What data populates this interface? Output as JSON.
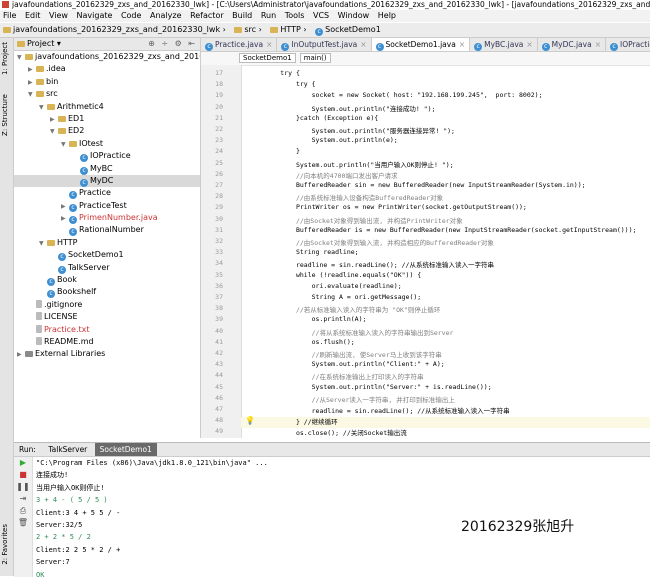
{
  "window": {
    "title": "javafoundations_20162329_zxs_and_20162330_lwk] - [C:\\Users\\Administrator\\javafoundations_20162329_zxs_and_20162330_lwk] - [javafoundations_20162329_zxs_and_20162330_lwk] - ...\\src"
  },
  "menu": [
    "File",
    "Edit",
    "View",
    "Navigate",
    "Code",
    "Analyze",
    "Refactor",
    "Build",
    "Run",
    "Tools",
    "VCS",
    "Window",
    "Help"
  ],
  "nav": {
    "project": "javafoundations_20162329_zxs_and_20162330_lwk",
    "src": "src",
    "http": "HTTP",
    "file": "SocketDemo1"
  },
  "left_tabs": {
    "project": "1: Project",
    "structure": "Z: Structure",
    "favorites": "2: Favorites"
  },
  "project_panel": {
    "title": "Project"
  },
  "tree": [
    {
      "label": "javafoundations_20162329_zxs_and_20162330_l",
      "depth": 0,
      "icon": "folder-icon",
      "open": true
    },
    {
      "label": ".idea",
      "depth": 1,
      "icon": "folder-icon",
      "open": false
    },
    {
      "label": "bin",
      "depth": 1,
      "icon": "folder-icon",
      "open": false
    },
    {
      "label": "src",
      "depth": 1,
      "icon": "folder-icon",
      "open": true
    },
    {
      "label": "Arithmetic4",
      "depth": 2,
      "icon": "folder-icon",
      "open": true
    },
    {
      "label": "ED1",
      "depth": 3,
      "icon": "folder-icon",
      "open": false
    },
    {
      "label": "ED2",
      "depth": 3,
      "icon": "folder-icon",
      "open": true
    },
    {
      "label": "IOtest",
      "depth": 4,
      "icon": "folder-icon",
      "open": true
    },
    {
      "label": "IOPractice",
      "depth": 5,
      "icon": "class-icon"
    },
    {
      "label": "MyBC",
      "depth": 5,
      "icon": "class-icon"
    },
    {
      "label": "MyDC",
      "depth": 5,
      "icon": "class-icon",
      "selected": true
    },
    {
      "label": "Practice",
      "depth": 4,
      "icon": "class-icon"
    },
    {
      "label": "PracticeTest",
      "depth": 4,
      "icon": "class-icon",
      "open": false
    },
    {
      "label": "PrimenNumber.java",
      "depth": 4,
      "icon": "class-icon",
      "open": false
    },
    {
      "label": "RationalNumber",
      "depth": 4,
      "icon": "class-icon"
    },
    {
      "label": "HTTP",
      "depth": 2,
      "icon": "folder-icon",
      "open": true
    },
    {
      "label": "SocketDemo1",
      "depth": 3,
      "icon": "class-icon"
    },
    {
      "label": "TalkServer",
      "depth": 3,
      "icon": "class-icon"
    },
    {
      "label": "Book",
      "depth": 2,
      "icon": "class-icon"
    },
    {
      "label": "Bookshelf",
      "depth": 2,
      "icon": "class-icon"
    },
    {
      "label": ".gitignore",
      "depth": 1,
      "icon": "file-icon"
    },
    {
      "label": "LICENSE",
      "depth": 1,
      "icon": "file-icon"
    },
    {
      "label": "Practice.txt",
      "depth": 1,
      "icon": "file-icon"
    },
    {
      "label": "README.md",
      "depth": 1,
      "icon": "file-icon"
    },
    {
      "label": "External Libraries",
      "depth": 0,
      "icon": "library-icon",
      "open": false
    }
  ],
  "tabs": [
    "Practice.java",
    "InOutputTest.java",
    "SocketDemo1.java",
    "MyBC.java",
    "MyDC.java",
    "IOPractice.java"
  ],
  "active_tab": 2,
  "code_crumbs": [
    "SocketDemo1",
    "main()"
  ],
  "code_lines": [
    {
      "n": "17",
      "t": "        try {"
    },
    {
      "n": "18",
      "t": "            try {"
    },
    {
      "n": "19",
      "t": "                socket = new Socket( host: \"192.168.199.245\",  port: 8002);"
    },
    {
      "n": "20",
      "t": "                System.out.println(\"连接成功! \");"
    },
    {
      "n": "21",
      "t": "            }catch (Exception e){"
    },
    {
      "n": "22",
      "t": "                System.out.println(\"服务器连接异常! \");"
    },
    {
      "n": "23",
      "t": "                System.out.println(e);"
    },
    {
      "n": "24",
      "t": "            }"
    },
    {
      "n": "25",
      "t": "            System.out.println(\"当用户输入OK则停止! \");"
    },
    {
      "n": "26",
      "t": "            //向本机的4700端口发出客户请求"
    },
    {
      "n": "27",
      "t": "            BufferedReader sin = new BufferedReader(new InputStreamReader(System.in));"
    },
    {
      "n": "28",
      "t": "            //由系统标准输入设备构造BufferedReader对象"
    },
    {
      "n": "29",
      "t": "            PrintWriter os = new PrintWriter(socket.getOutputStream());"
    },
    {
      "n": "30",
      "t": "            //由Socket对象得到输出流, 并构造PrintWriter对象"
    },
    {
      "n": "31",
      "t": "            BufferedReader is = new BufferedReader(new InputStreamReader(socket.getInputStream()));"
    },
    {
      "n": "32",
      "t": "            //由Socket对象得到输入流, 并构造相应的BufferedReader对象"
    },
    {
      "n": "33",
      "t": "            String readline;"
    },
    {
      "n": "34",
      "t": "            readline = sin.readLine(); //从系统标准输入读入一字符串"
    },
    {
      "n": "35",
      "t": "            while (!readline.equals(\"OK\")) {"
    },
    {
      "n": "36",
      "t": "                ori.evaluate(readline);"
    },
    {
      "n": "37",
      "t": "                String A = ori.getMessage();"
    },
    {
      "n": "38",
      "t": "            //若从标准输入读入的字符串为 \"OK\"则停止循环"
    },
    {
      "n": "39",
      "t": "                os.println(A);"
    },
    {
      "n": "40",
      "t": "                //将从系统标准输入读入的字符串输出到Server"
    },
    {
      "n": "41",
      "t": "                os.flush();"
    },
    {
      "n": "42",
      "t": "                //刷新输出流, 使Server马上收到该字符串"
    },
    {
      "n": "43",
      "t": "                System.out.println(\"Client:\" + A);"
    },
    {
      "n": "44",
      "t": "                //在系统标准输出上打印读入的字符串"
    },
    {
      "n": "45",
      "t": "                System.out.println(\"Server:\" + is.readLine());"
    },
    {
      "n": "46",
      "t": "                //从Server读入一字符串, 并打印到标准输出上"
    },
    {
      "n": "47",
      "t": "                readline = sin.readLine(); //从系统标准输入读入一字符串"
    },
    {
      "n": "48",
      "t": "            } //继续循环"
    },
    {
      "n": "49",
      "t": "            os.close(); //关闭Socket输出流"
    }
  ],
  "run_tabs": {
    "label": "Run:",
    "tab1": "TalkServer",
    "tab2": "SocketDemo1"
  },
  "console_lines": [
    {
      "t": "\"C:\\Program Files (x86)\\Java\\jdk1.8.0_121\\bin\\java\" ...",
      "c": "#000"
    },
    {
      "t": "连接成功!",
      "c": "#000"
    },
    {
      "t": "当用户输入OK则停止!",
      "c": "#000"
    },
    {
      "t": "3 + 4 - ( 5 / 5 )",
      "c": "#2e8b57"
    },
    {
      "t": "Client:3 4 + 5 5 / -",
      "c": "#000"
    },
    {
      "t": "Server:32/5",
      "c": "#000"
    },
    {
      "t": "2 + 2 * 5 / 2",
      "c": "#2e8b57"
    },
    {
      "t": "Client:2 2 5 * 2 / +",
      "c": "#000"
    },
    {
      "t": "Server:7",
      "c": "#000"
    },
    {
      "t": "OK",
      "c": "#2e8b57"
    }
  ],
  "signature": "20162329张旭升"
}
